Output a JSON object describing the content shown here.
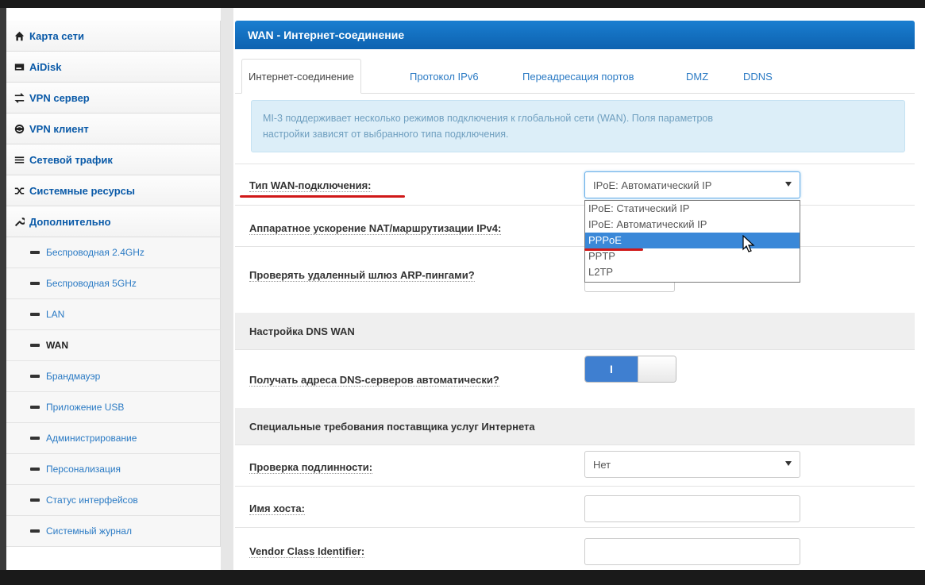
{
  "sidebar": {
    "main_items": [
      {
        "label": "Карта сети",
        "icon": "home-icon"
      },
      {
        "label": "AiDisk",
        "icon": "disk-icon"
      },
      {
        "label": "VPN сервер",
        "icon": "vpn-server-icon"
      },
      {
        "label": "VPN клиент",
        "icon": "globe-icon"
      },
      {
        "label": "Сетевой трафик",
        "icon": "traffic-icon"
      },
      {
        "label": "Системные ресурсы",
        "icon": "shuffle-icon"
      },
      {
        "label": "Дополнительно",
        "icon": "wrench-icon"
      }
    ],
    "sub_items": [
      "Беспроводная 2.4GHz",
      "Беспроводная 5GHz",
      "LAN",
      "WAN",
      "Брандмауэр",
      "Приложение USB",
      "Администрирование",
      "Персонализация",
      "Статус интерфейсов",
      "Системный журнал"
    ],
    "active_sub": "WAN"
  },
  "header": {
    "title": "WAN - Интернет-соединение"
  },
  "tabs": [
    {
      "label": "Интернет-соединение",
      "active": true
    },
    {
      "label": "Протокол IPv6",
      "active": false
    },
    {
      "label": "Переадресация портов",
      "active": false
    },
    {
      "label": "DMZ",
      "active": false
    },
    {
      "label": "DDNS",
      "active": false
    }
  ],
  "info": {
    "line1": "MI-3 поддерживает несколько режимов подключения к глобальной сети (WAN). Поля параметров",
    "line2": "настройки зависят от выбранного типа подключения."
  },
  "form": {
    "wan_type_label": "Тип WAN-подключения:",
    "wan_type_value": "IPoE: Автоматический IP",
    "wan_type_options": [
      "IPoE: Статический IP",
      "IPoE: Автоматический IP",
      "PPPoE",
      "PPTP",
      "L2TP"
    ],
    "wan_type_highlighted": "PPPoE",
    "nat_label": "Аппаратное ускорение NAT/маршрутизации IPv4:",
    "arp_label": "Проверять удаленный шлюз ARP-пингами?",
    "dns_section": "Настройка DNS WAN",
    "dns_auto_label": "Получать адреса DNS-серверов автоматически?",
    "dns_auto_toggle": "I",
    "isp_section": "Специальные требования поставщика услуг Интернета",
    "auth_label": "Проверка подлинности:",
    "auth_value": "Нет",
    "hostname_label": "Имя хоста:",
    "hostname_value": "",
    "vendor_label": "Vendor Class Identifier:",
    "vendor_value": ""
  },
  "colors": {
    "header_blue": "#0d62b0",
    "link_blue": "#2a7ac4",
    "highlight_blue": "#3a88d8",
    "annotation_red": "#d01818"
  }
}
